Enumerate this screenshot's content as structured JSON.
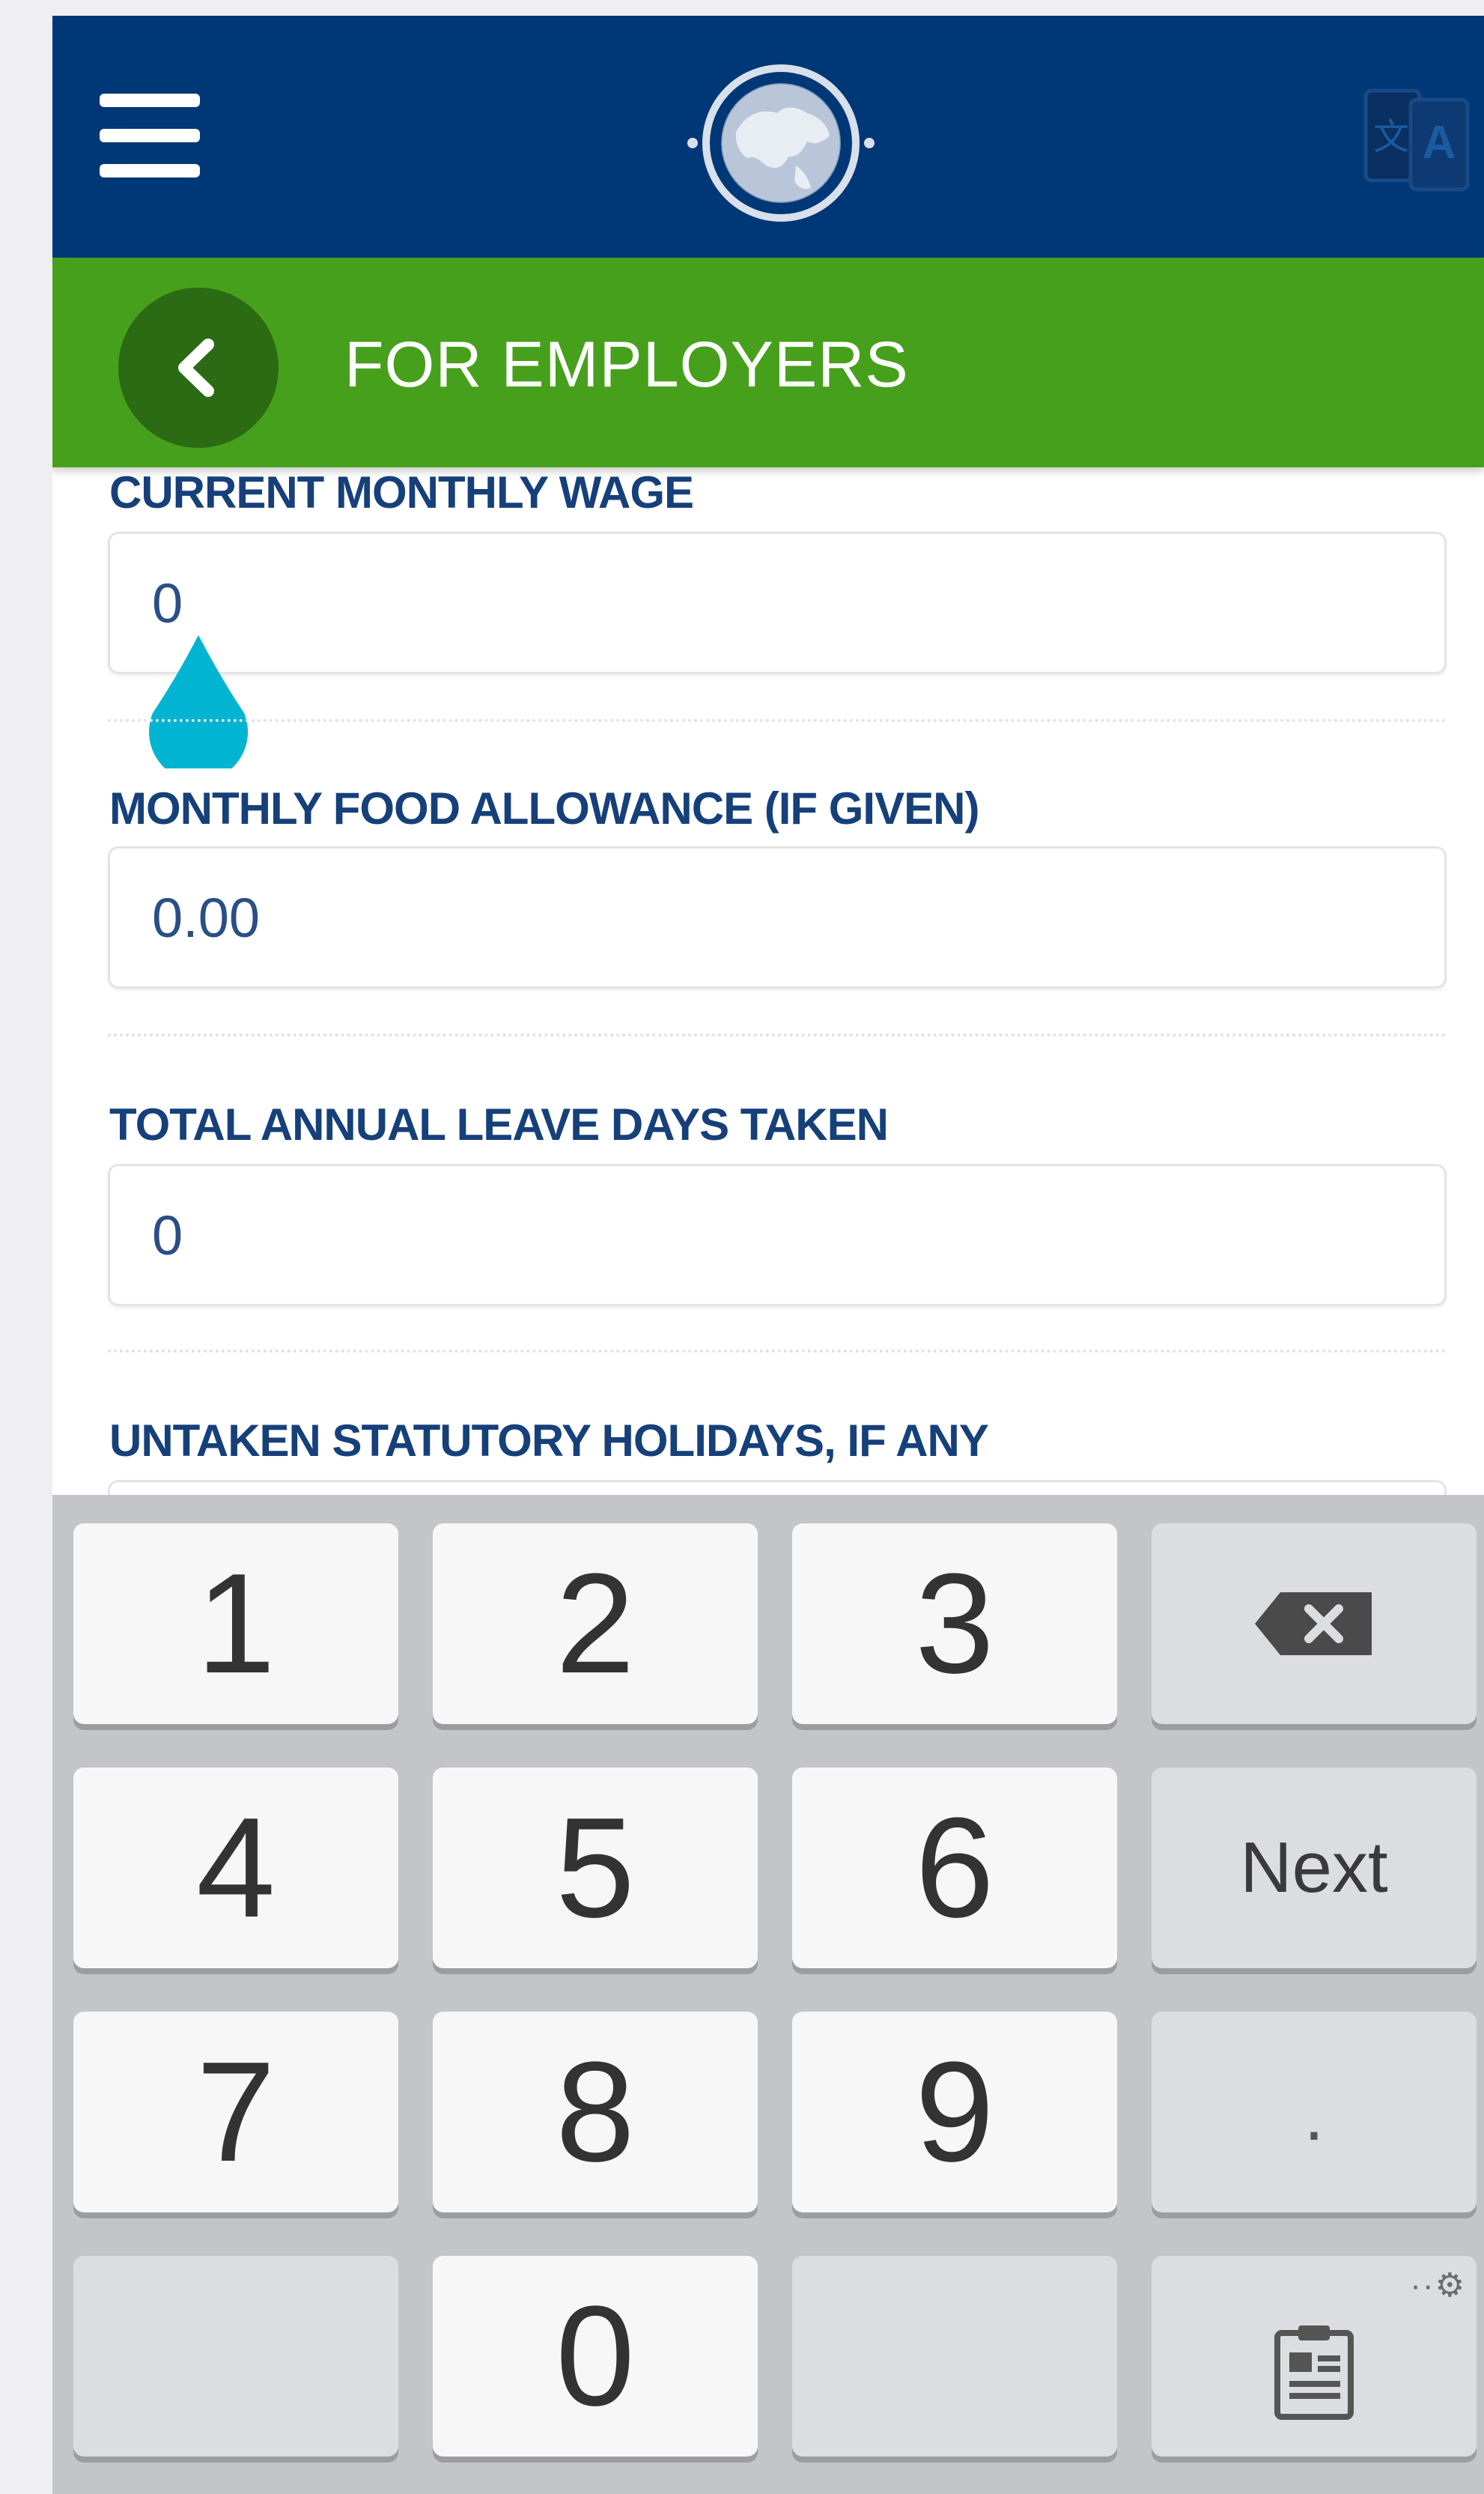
{
  "app_bar": {
    "menu_icon": "hamburger-menu-icon",
    "logo_icon": "globe-logo-icon",
    "language_icon": "translate-language-icon",
    "background": "#003776"
  },
  "sub_bar": {
    "title": "FOR EMPLOYERS",
    "back_icon": "chevron-left-icon",
    "background": "#47a01c"
  },
  "form": {
    "fields": [
      {
        "label": "CURRENT MONTHLY WAGE",
        "value": "0"
      },
      {
        "label": "MONTHLY FOOD ALLOWANCE (IF GIVEN)",
        "value": "0.00"
      },
      {
        "label": "TOTAL ANNUAL LEAVE DAYS TAKEN",
        "value": "0"
      },
      {
        "label": "UNTAKEN STATUTORY HOLIDAYS, IF ANY",
        "value": ""
      }
    ],
    "label_color": "#16407a",
    "cursor_handle_color": "#00b4d2"
  },
  "keyboard": {
    "keys": [
      [
        "1",
        "2",
        "3",
        "⌫"
      ],
      [
        "4",
        "5",
        "6",
        "Next"
      ],
      [
        "7",
        "8",
        "9",
        "."
      ],
      [
        "",
        "0",
        "",
        "clipboard"
      ]
    ],
    "backspace_icon": "backspace-icon",
    "clipboard_icon": "clipboard-icon",
    "settings_icon": "keyboard-settings-icon"
  }
}
